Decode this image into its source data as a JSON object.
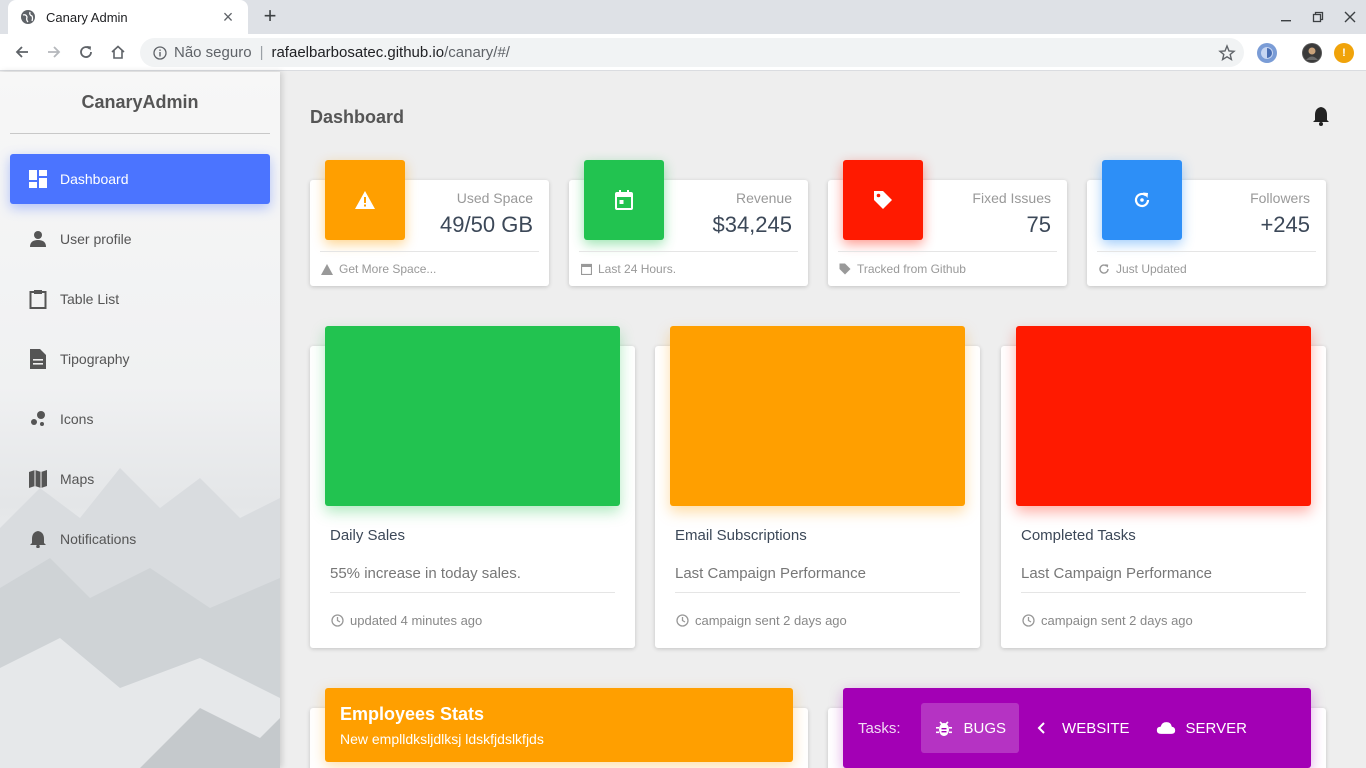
{
  "browser": {
    "tab_title": "Canary Admin",
    "security_label": "Não seguro",
    "url_host": "rafaelbarbosatec.github.io",
    "url_path": "/canary/#/",
    "separator": "|"
  },
  "sidebar": {
    "brand": "CanaryAdmin",
    "items": [
      {
        "label": "Dashboard",
        "icon": "dashboard-icon",
        "active": true
      },
      {
        "label": "User profile",
        "icon": "person-icon"
      },
      {
        "label": "Table List",
        "icon": "clipboard-icon"
      },
      {
        "label": "Tipography",
        "icon": "document-icon"
      },
      {
        "label": "Icons",
        "icon": "bubbles-icon"
      },
      {
        "label": "Maps",
        "icon": "map-icon"
      },
      {
        "label": "Notifications",
        "icon": "bell-icon"
      }
    ]
  },
  "header": {
    "title": "Dashboard"
  },
  "stats": [
    {
      "label": "Used Space",
      "value": "49/50 GB",
      "footer": "Get More Space...",
      "color": "#ff9f00",
      "icon": "warning-icon"
    },
    {
      "label": "Revenue",
      "value": "$34,245",
      "footer": "Last 24 Hours.",
      "color": "#22c350",
      "icon": "calendar-icon"
    },
    {
      "label": "Fixed Issues",
      "value": "75",
      "footer": "Tracked from Github",
      "color": "#ff1a00",
      "icon": "tag-icon"
    },
    {
      "label": "Followers",
      "value": "+245",
      "footer": "Just Updated",
      "color": "#2d8ff7",
      "icon": "refresh-icon"
    }
  ],
  "charts": [
    {
      "title": "Daily Sales",
      "desc": "55% increase in today sales.",
      "footer": "updated 4 minutes ago",
      "color": "#22c350"
    },
    {
      "title": "Email Subscriptions",
      "desc": "Last Campaign Performance",
      "footer": "campaign sent 2 days ago",
      "color": "#ff9f00"
    },
    {
      "title": "Completed Tasks",
      "desc": "Last Campaign Performance",
      "footer": "campaign sent 2 days ago",
      "color": "#ff1a00"
    }
  ],
  "employees": {
    "title": "Employees Stats",
    "subtitle": "New emplldkslјdlksj ldskfjdslkfjds"
  },
  "tasks": {
    "label": "Tasks:",
    "tabs": [
      {
        "label": "BUGS",
        "icon": "bug-icon",
        "active": true
      },
      {
        "label": "WEBSITE",
        "icon": "code-icon"
      },
      {
        "label": "SERVER",
        "icon": "cloud-icon"
      }
    ]
  }
}
